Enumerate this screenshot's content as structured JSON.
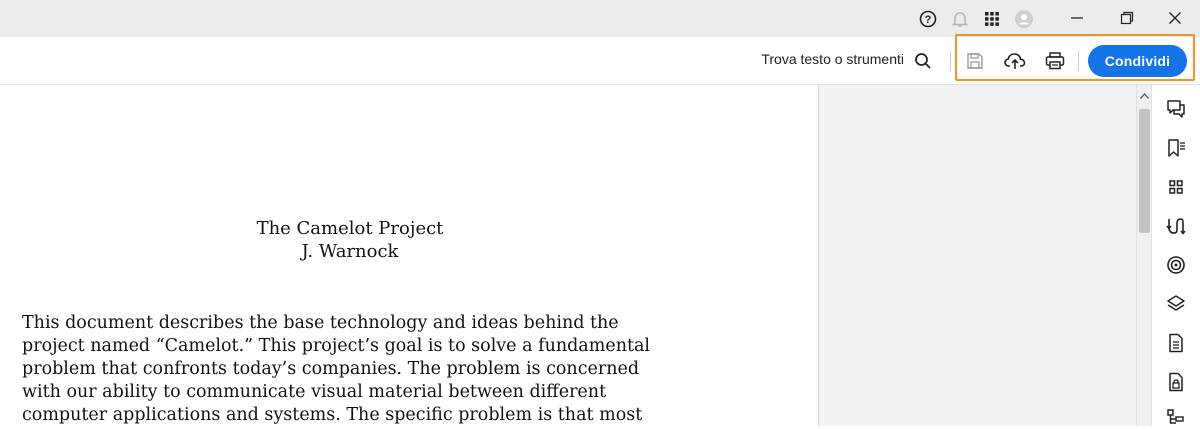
{
  "titlebar": {
    "icons": [
      "help-icon",
      "bell-icon",
      "apps-grid-icon",
      "account-avatar-icon"
    ],
    "window_controls": [
      "minimize-icon",
      "restore-icon",
      "close-icon"
    ]
  },
  "toolbar": {
    "search_label": "Trova testo o strumenti",
    "tools": [
      "save-icon",
      "cloud-upload-icon",
      "print-icon"
    ],
    "share_label": "Condividi",
    "accent_color": "#1473e6",
    "highlight_color": "#f29423"
  },
  "document": {
    "title": "The Camelot Project",
    "author": "J. Warnock",
    "paragraph_lines": [
      "This document describes the base technology and ideas behind the",
      "project named “Camelot.” This project’s goal is to solve a fundamental",
      "problem that confronts today’s companies. The problem is concerned",
      "with our ability to communicate visual material between different",
      "computer applications and systems. The specific problem is that most"
    ]
  },
  "right_rail": {
    "icons": [
      "comment-icon",
      "bookmark-list-icon",
      "thumbnails-icon",
      "compare-icon",
      "target-icon",
      "layers-icon",
      "document-icon",
      "document-lock-icon",
      "structure-icon"
    ]
  }
}
